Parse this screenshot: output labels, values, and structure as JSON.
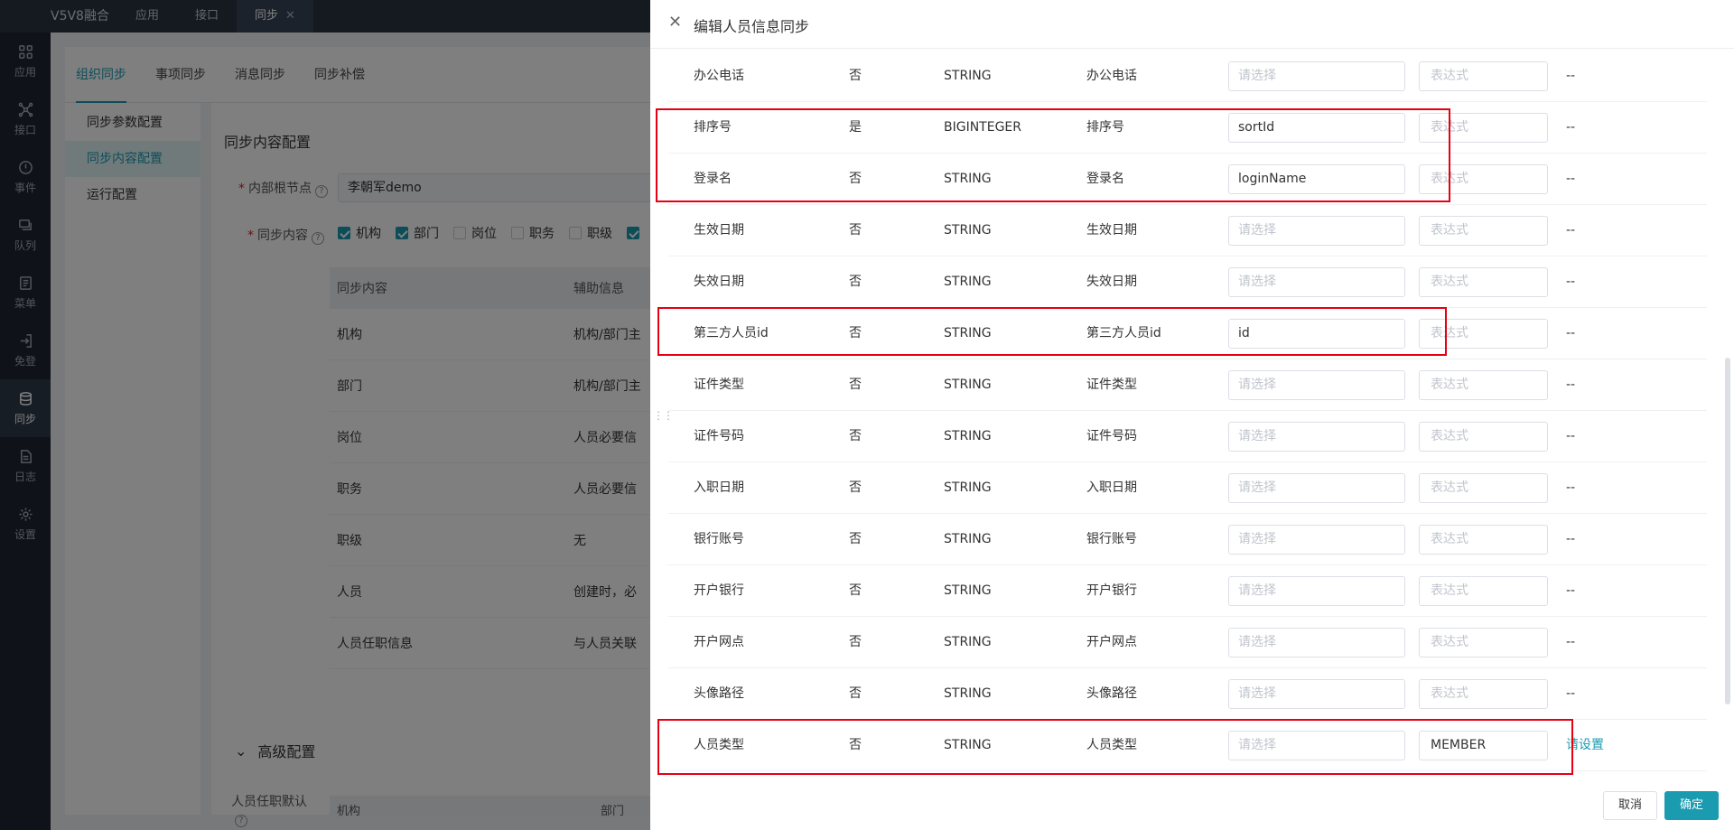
{
  "app": {
    "title": "V5V8融合"
  },
  "top_tabs": [
    {
      "label": "应用"
    },
    {
      "label": "接口"
    },
    {
      "label": "同步",
      "close": "✕"
    }
  ],
  "sidenav": [
    {
      "label": "应用",
      "icon": "apps-icon"
    },
    {
      "label": "接口",
      "icon": "interface-icon"
    },
    {
      "label": "事件",
      "icon": "event-icon"
    },
    {
      "label": "队列",
      "icon": "queue-icon"
    },
    {
      "label": "菜单",
      "icon": "menu-doc-icon"
    },
    {
      "label": "免登",
      "icon": "login-icon"
    },
    {
      "label": "同步",
      "icon": "database-icon"
    },
    {
      "label": "日志",
      "icon": "log-icon"
    },
    {
      "label": "设置",
      "icon": "gear-icon"
    }
  ],
  "sub_tabs": [
    "组织同步",
    "事项同步",
    "消息同步",
    "同步补偿"
  ],
  "left_panel": [
    "同步参数配置",
    "同步内容配置",
    "运行配置"
  ],
  "main": {
    "title": "同步内容配置",
    "root_label": "内部根节点",
    "root_value": "李朝军demo",
    "content_label": "同步内容",
    "checks": [
      {
        "label": "机构",
        "checked": true
      },
      {
        "label": "部门",
        "checked": true
      },
      {
        "label": "岗位",
        "checked": false
      },
      {
        "label": "职务",
        "checked": false
      },
      {
        "label": "职级",
        "checked": false
      }
    ],
    "table_head": [
      "同步内容",
      "辅助信息"
    ],
    "table_rows": [
      [
        "机构",
        "机构/部门主"
      ],
      [
        "部门",
        "机构/部门主"
      ],
      [
        "岗位",
        "人员必要信"
      ],
      [
        "职务",
        "人员必要信"
      ],
      [
        "职级",
        "无"
      ],
      [
        "人员",
        "创建时，必"
      ],
      [
        "人员任职信息",
        "与人员关联"
      ]
    ],
    "advanced": "高级配置",
    "advanced_label": "人员任职默认",
    "bottom_head": [
      "机构",
      "部门"
    ]
  },
  "drawer": {
    "title": "编辑人员信息同步",
    "rows": [
      {
        "name": "办公电话",
        "required": "否",
        "type": "STRING",
        "label": "办公电话",
        "source": "请选择",
        "source_filled": false,
        "expr": "表达式",
        "expr_filled": false,
        "action": "--"
      },
      {
        "name": "排序号",
        "required": "是",
        "type": "BIGINTEGER",
        "label": "排序号",
        "source": "sortId",
        "source_filled": true,
        "expr": "表达式",
        "expr_filled": false,
        "action": "--"
      },
      {
        "name": "登录名",
        "required": "否",
        "type": "STRING",
        "label": "登录名",
        "source": "loginName",
        "source_filled": true,
        "expr": "表达式",
        "expr_filled": false,
        "action": "--"
      },
      {
        "name": "生效日期",
        "required": "否",
        "type": "STRING",
        "label": "生效日期",
        "source": "请选择",
        "source_filled": false,
        "expr": "表达式",
        "expr_filled": false,
        "action": "--"
      },
      {
        "name": "失效日期",
        "required": "否",
        "type": "STRING",
        "label": "失效日期",
        "source": "请选择",
        "source_filled": false,
        "expr": "表达式",
        "expr_filled": false,
        "action": "--"
      },
      {
        "name": "第三方人员id",
        "required": "否",
        "type": "STRING",
        "label": "第三方人员id",
        "source": "id",
        "source_filled": true,
        "expr": "表达式",
        "expr_filled": false,
        "action": "--"
      },
      {
        "name": "证件类型",
        "required": "否",
        "type": "STRING",
        "label": "证件类型",
        "source": "请选择",
        "source_filled": false,
        "expr": "表达式",
        "expr_filled": false,
        "action": "--"
      },
      {
        "name": "证件号码",
        "required": "否",
        "type": "STRING",
        "label": "证件号码",
        "source": "请选择",
        "source_filled": false,
        "expr": "表达式",
        "expr_filled": false,
        "action": "--"
      },
      {
        "name": "入职日期",
        "required": "否",
        "type": "STRING",
        "label": "入职日期",
        "source": "请选择",
        "source_filled": false,
        "expr": "表达式",
        "expr_filled": false,
        "action": "--"
      },
      {
        "name": "银行账号",
        "required": "否",
        "type": "STRING",
        "label": "银行账号",
        "source": "请选择",
        "source_filled": false,
        "expr": "表达式",
        "expr_filled": false,
        "action": "--"
      },
      {
        "name": "开户银行",
        "required": "否",
        "type": "STRING",
        "label": "开户银行",
        "source": "请选择",
        "source_filled": false,
        "expr": "表达式",
        "expr_filled": false,
        "action": "--"
      },
      {
        "name": "开户网点",
        "required": "否",
        "type": "STRING",
        "label": "开户网点",
        "source": "请选择",
        "source_filled": false,
        "expr": "表达式",
        "expr_filled": false,
        "action": "--"
      },
      {
        "name": "头像路径",
        "required": "否",
        "type": "STRING",
        "label": "头像路径",
        "source": "请选择",
        "source_filled": false,
        "expr": "表达式",
        "expr_filled": false,
        "action": "--"
      },
      {
        "name": "人员类型",
        "required": "否",
        "type": "STRING",
        "label": "人员类型",
        "source": "请选择",
        "source_filled": false,
        "expr": "MEMBER",
        "expr_filled": true,
        "action": "请设置",
        "action_link": true
      }
    ],
    "cancel": "取消",
    "confirm": "确定"
  },
  "colors": {
    "accent": "#1a9bb0",
    "highlight": "#e60012"
  }
}
